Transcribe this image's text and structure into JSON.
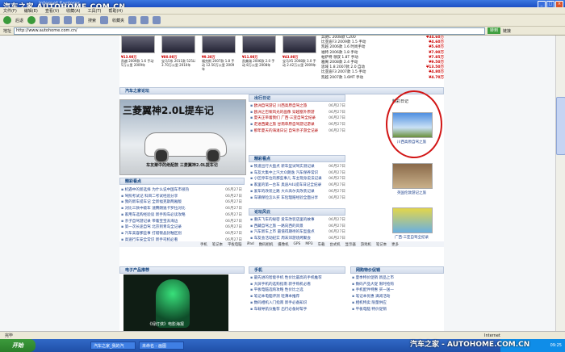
{
  "watermark_top": "汽车之家 AUTOHOME.COM.CN",
  "watermark_bottom": "汽车之家 - AUTOHOME.COM.CN",
  "window": {
    "title": "Internet Explorer",
    "min": "_",
    "max": "□",
    "close": "×"
  },
  "menu": [
    "文件(F)",
    "编辑(E)",
    "查看(V)",
    "收藏(A)",
    "工具(T)",
    "帮助(H)"
  ],
  "toolbar": {
    "back": "后退",
    "search": "搜索",
    "favorites": "收藏夹"
  },
  "address": {
    "label": "地址",
    "value": "http://www.autohome.com.cn/",
    "go": "转到",
    "links": "链接"
  },
  "status": {
    "text": "完毕",
    "zone": "Internet"
  },
  "taskbar": {
    "start": "开始",
    "task1": "汽车之家_我的汽",
    "task2": "未命名 - 画图",
    "clock": "09:25"
  },
  "used_cars": [
    {
      "price": "¥13.98万",
      "desc": "凯越 2009款 1.6 手动 5万公里 2009年"
    },
    {
      "price": "¥80.98万",
      "desc": "宝马5系 2011款 525Li 3.70万公里 2010年"
    },
    {
      "price": "¥9.38万",
      "desc": "福克斯 2007款 1.8 手动 12.50万公里 2009年"
    },
    {
      "price": "¥11.98万",
      "desc": "凯美瑞 2006款 2.0 手动 8万公里 2008年"
    },
    {
      "price": "¥43.98万",
      "desc": "宝马X5 2008款 3.0 手动 2.42万公里 2009年"
    }
  ],
  "price_list": [
    {
      "name": "奔驰C 2008款 C200",
      "price": "¥34.60万"
    },
    {
      "name": "比亚迪F3 2009款 1.5 手动",
      "price": "¥4.60万"
    },
    {
      "name": "凯越 2006款 1.6 时尚手动",
      "price": "¥5.60万"
    },
    {
      "name": "福特 2006款 1.8 手动",
      "price": "¥7.90万"
    },
    {
      "name": "帕萨特 领驭 1.8T 手动",
      "price": "¥7.85万"
    },
    {
      "name": "雅阁 2008款 2.4 手动",
      "price": "¥9.50万"
    },
    {
      "name": "思域 1.8 2007款 2.0 自动",
      "price": "¥13.50万"
    },
    {
      "name": "比亚迪F3 2007款 1.5 手动",
      "price": "¥4.80万"
    },
    {
      "name": "凯越 2007款 1.6MT 手动",
      "price": "¥4.70万"
    }
  ],
  "sections": {
    "forum": "汽车之家论坛",
    "travel": "出行日记",
    "wonderful": "精彩看点",
    "diary": "精彩日记",
    "forum2": "论坛风云",
    "products": "电子产品推荐",
    "phone": "手机",
    "network": "网购特价促销"
  },
  "hero": {
    "title": "三菱翼神2.0L提车记",
    "caption": "车友聚中的绝配款 三菱翼神2.0L提车记"
  },
  "travel_news": [
    {
      "title": "欧洲自驾游记 川西高原自驾之旅",
      "date": "06月27日"
    },
    {
      "title": "欧洲之巴黎风光的画像 穿越塞外原游",
      "date": "06月27日"
    },
    {
      "title": "夏天正带着我们 广西·三亚自驾全纪录",
      "date": "06月27日"
    },
    {
      "title": "走进西藏之旅 甘南草原自驾游记游录",
      "date": "06月27日"
    },
    {
      "title": "那年夏天的海滩日记 自驾亲子游全记录",
      "date": "06月27日"
    }
  ],
  "wonderful_news": [
    {
      "title": "铁道出行大盘点 新车型试驾实测记录",
      "date": "06月27日"
    },
    {
      "title": "车友大集中上汽大众朗逸 汽车保养常识",
      "date": "06月27日"
    },
    {
      "title": "小区停车位的那些事儿 车主现身说法记录",
      "date": "06月27日"
    },
    {
      "title": "家里的第一台车 奥迪A4L提车日记全纪录",
      "date": "06月27日"
    },
    {
      "title": "爱车的改装之路 大众高尔夫改装记录",
      "date": "06月27日"
    },
    {
      "title": "车辆保险怎么买 车险理赔经验全面分享",
      "date": "06月27日"
    }
  ],
  "forum_news": [
    {
      "title": "机遇中的新选择 为什么说中国车市很热",
      "date": "06月27日"
    },
    {
      "title": "驾照考试记 科目二考试经验分享",
      "date": "06月27日"
    },
    {
      "title": "我的新车提车记 全新福克斯两厢版",
      "date": "06月27日"
    },
    {
      "title": "对比三款中级车 速腾朗逸卡罗拉对比",
      "date": "06月27日"
    },
    {
      "title": "家用车选购经验谈 新手购车必读攻略",
      "date": "06月27日"
    },
    {
      "title": "亲子自驾游记录 带着宝宝去海边",
      "date": "06月27日"
    },
    {
      "title": "第一次长途自驾 北京到青岛全记录",
      "date": "06月27日"
    },
    {
      "title": "汽车美容那些事 打蜡镀晶封釉区别",
      "date": "06月27日"
    },
    {
      "title": "高速行车安全常识 新手司机必看",
      "date": "06月27日"
    },
    {
      "title": "夏季用车小窍门 空调使用注意事项",
      "date": "06月27日"
    }
  ],
  "forum2_news": [
    {
      "title": "重庆飞车的秘密 爱车改装店里的故事",
      "date": "06月27日"
    },
    {
      "title": "西藏自驾之旅 一路向西的风景",
      "date": "06月27日"
    },
    {
      "title": "汽车新车上市 最值得期待的车型盘点",
      "date": "06月27日"
    },
    {
      "title": "车友会活动纪实 周末郊游烧烤聚会",
      "date": "06月27日"
    },
    {
      "title": "新手驾驶技巧分享 倒车入库不再难",
      "date": "06月27日"
    },
    {
      "title": "汽车保养周期表 机油更换时间说明",
      "date": "06月27日"
    }
  ],
  "diary_thumbs": [
    {
      "caption": "川西高原自驾之旅"
    },
    {
      "caption": "英国伦敦游记之旅"
    },
    {
      "caption": "广西·三亚自驾全纪录"
    }
  ],
  "brands": [
    "手机",
    "笔记本",
    "平板电脑",
    "iPad",
    "数码相机",
    "摄像机",
    "GPS",
    "MP3",
    "车载",
    "台式机",
    "显示器",
    "游戏机",
    "笔记本",
    "更多"
  ],
  "phone_news": [
    "最先进的智能手机 性价比最高的手机推荐",
    "大屏手机的选购指南 新手购机必看",
    "平板电脑选购攻略 性价比之选",
    "笔记本电脑评测 轻薄本推荐",
    "数码相机入门指南 新手必备知识",
    "车载导航仪推荐 出行必备好帮手"
  ],
  "promo_news": [
    "夏季特价促销 新品上市",
    "数码产品大促 限时抢购",
    "手机配件特惠 买一送一",
    "笔记本优惠 满减活动",
    "相机特卖 限量供应",
    "平板电脑 特价促销"
  ],
  "product_image_caption": "《绿灯侠》电影海报"
}
